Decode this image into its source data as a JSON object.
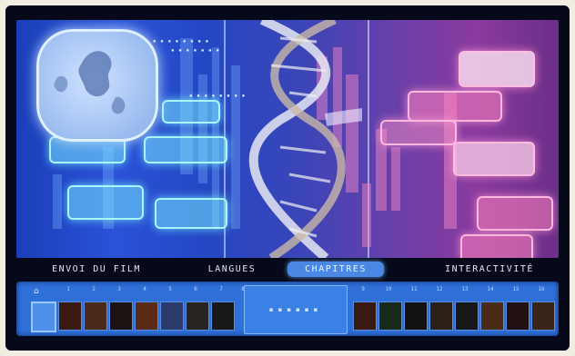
{
  "menu": {
    "items": [
      {
        "label": "ENVOI DU FILM",
        "active": false
      },
      {
        "label": "LANGUES",
        "active": false
      },
      {
        "label": "CHAPITRES",
        "active": true
      },
      {
        "label": "INTERACTIVITÉ",
        "active": false
      }
    ]
  },
  "chapters": {
    "home_icon": "home-icon",
    "left_numbers": [
      "1",
      "2",
      "3",
      "4",
      "5",
      "6",
      "7",
      "8"
    ],
    "right_numbers": [
      "9",
      "10",
      "11",
      "12",
      "13",
      "14",
      "15",
      "16"
    ],
    "selected_index": 0
  },
  "colors": {
    "active_tab": "#4a88e6",
    "strip": "#2e6fd8",
    "cyan_glow": "#78e6ff",
    "pink_glow": "#ff82be"
  }
}
